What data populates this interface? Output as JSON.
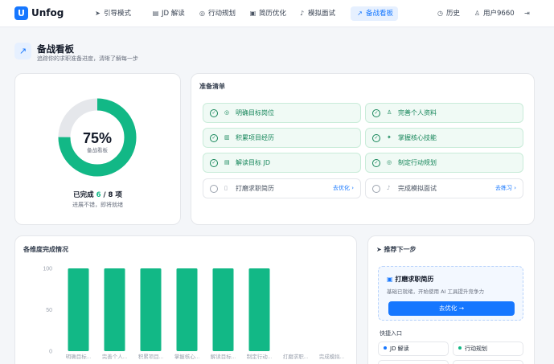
{
  "nav": {
    "brand": "Unfog",
    "logo_letter": "U",
    "items": [
      {
        "icon": "send-icon",
        "glyph": "➤",
        "label": "引导模式"
      },
      {
        "icon": "document-icon",
        "glyph": "▤",
        "label": "JD 解读"
      },
      {
        "icon": "target-icon",
        "glyph": "◎",
        "label": "行动规划"
      },
      {
        "icon": "file-edit-icon",
        "glyph": "▣",
        "label": "简历优化"
      },
      {
        "icon": "microphone-icon",
        "glyph": "♪",
        "label": "模拟面试"
      },
      {
        "icon": "trending-up-icon",
        "glyph": "↗",
        "label": "备战看板"
      }
    ],
    "history_label": "历史",
    "user_label": "用户9660"
  },
  "page": {
    "title": "备战看板",
    "subtitle": "追踪你的求职准备进度，清晰了解每一步"
  },
  "progress": {
    "percent": 75,
    "percent_label": "75%",
    "ring_label": "备战看板",
    "done_prefix": "已完成",
    "done_count": "6",
    "done_suffix": "/ 8 项",
    "note": "进展不错，即将就绪"
  },
  "checklist": {
    "title": "准备清单",
    "items": [
      {
        "label": "明确目标岗位",
        "done": true,
        "icon": "target-icon",
        "glyph": "◎"
      },
      {
        "label": "完善个人资料",
        "done": true,
        "icon": "user-icon",
        "glyph": "♙"
      },
      {
        "label": "积累项目经历",
        "done": true,
        "icon": "briefcase-icon",
        "glyph": "▥"
      },
      {
        "label": "掌握核心技能",
        "done": true,
        "icon": "sparkle-icon",
        "glyph": "✦"
      },
      {
        "label": "解读目标 JD",
        "done": true,
        "icon": "document-icon",
        "glyph": "▤"
      },
      {
        "label": "制定行动规划",
        "done": true,
        "icon": "target-icon",
        "glyph": "◎"
      },
      {
        "label": "打磨求职简历",
        "done": false,
        "icon": "file-icon",
        "glyph": "▯",
        "action": "去优化"
      },
      {
        "label": "完成模拟面试",
        "done": false,
        "icon": "microphone-icon",
        "glyph": "♪",
        "action": "去练习"
      }
    ]
  },
  "dimension": {
    "title": "各维度完成情况"
  },
  "chart_data": {
    "type": "bar",
    "categories": [
      "明确目标...",
      "完善个人...",
      "积累项目...",
      "掌握核心...",
      "解读目标...",
      "制定行动...",
      "打磨求职...",
      "完成模拟..."
    ],
    "values": [
      100,
      100,
      100,
      100,
      100,
      100,
      0,
      0
    ],
    "yticks": [
      0,
      50,
      100
    ],
    "ylim": [
      0,
      100
    ],
    "bar_color": "#12b886"
  },
  "next": {
    "title": "推荐下一步",
    "rec_title": "打磨求职简历",
    "rec_desc": "基础已就绪，开始使用 AI 工具提升竞争力",
    "button": "去优化",
    "quick_title": "快捷入口",
    "quick": [
      {
        "label": "JD 解读",
        "color": "#1677ff"
      },
      {
        "label": "行动规划",
        "color": "#12b886"
      }
    ]
  },
  "colors": {
    "accent": "#1677ff",
    "success": "#12b886",
    "ring_track": "#e5e7eb"
  }
}
